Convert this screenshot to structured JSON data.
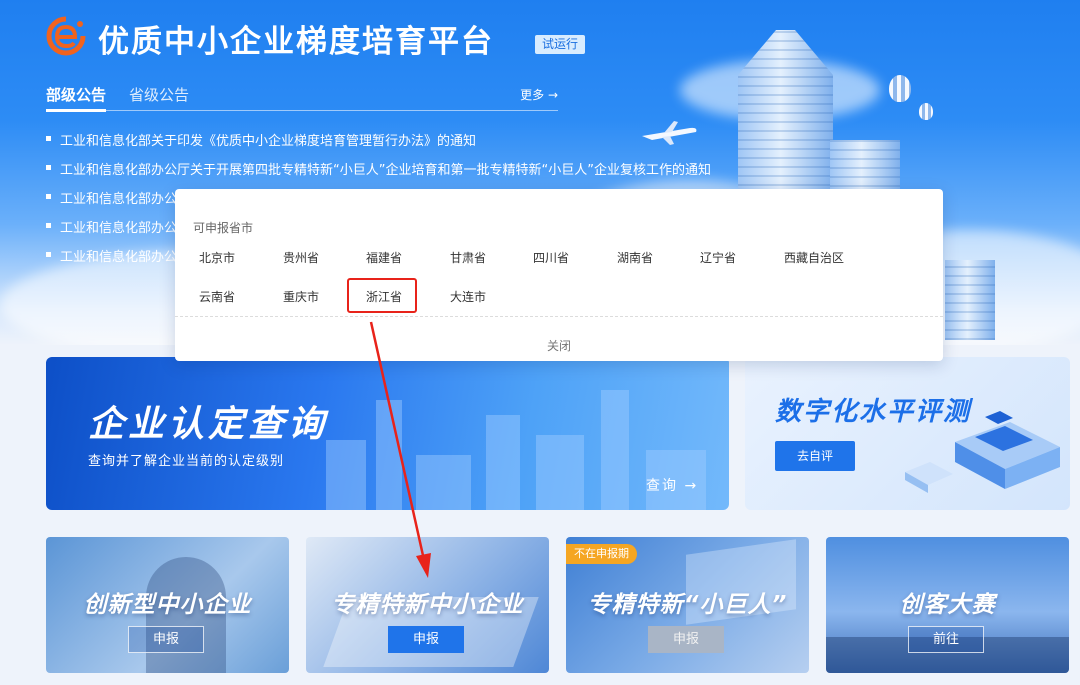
{
  "header": {
    "site_title": "优质中小企业梯度培育平台",
    "trial_badge": "试运行"
  },
  "announcements": {
    "tabs": [
      {
        "label": "部级公告",
        "active": true
      },
      {
        "label": "省级公告",
        "active": false
      }
    ],
    "more_label": "更多 →",
    "items": [
      "工业和信息化部关于印发《优质中小企业梯度培育管理暂行办法》的通知",
      "工业和信息化部办公厅关于开展第四批专精特新“小巨人”企业培育和第一批专精特新“小巨人”企业复核工作的通知",
      "工业和信息化部办公",
      "工业和信息化部办公",
      "工业和信息化部办公"
    ]
  },
  "province_popup": {
    "heading": "可申报省市",
    "provinces": [
      "北京市",
      "贵州省",
      "福建省",
      "甘肃省",
      "四川省",
      "湖南省",
      "辽宁省",
      "西藏自治区",
      "云南省",
      "重庆市",
      "浙江省",
      "大连市"
    ],
    "highlighted": "浙江省",
    "close_label": "关闭"
  },
  "query_card": {
    "title": "企业认定查询",
    "subtitle": "查询并了解企业当前的认定级别",
    "action_label": "查询 →"
  },
  "digital_card": {
    "title": "数字化水平评测",
    "button_label": "去自评"
  },
  "tiles": [
    {
      "title": "创新型中小企业",
      "button_label": "申报",
      "button_state": "outline",
      "tag": ""
    },
    {
      "title": "专精特新中小企业",
      "button_label": "申报",
      "button_state": "primary",
      "tag": ""
    },
    {
      "title": "专精特新“小巨人”",
      "button_label": "申报",
      "button_state": "disabled",
      "tag": "不在申报期"
    },
    {
      "title": "创客大赛",
      "button_label": "前往",
      "button_state": "outline",
      "tag": ""
    }
  ],
  "colors": {
    "brand_blue": "#1f74ea",
    "highlight_red": "#e8231a",
    "tag_orange": "#f5a623"
  }
}
